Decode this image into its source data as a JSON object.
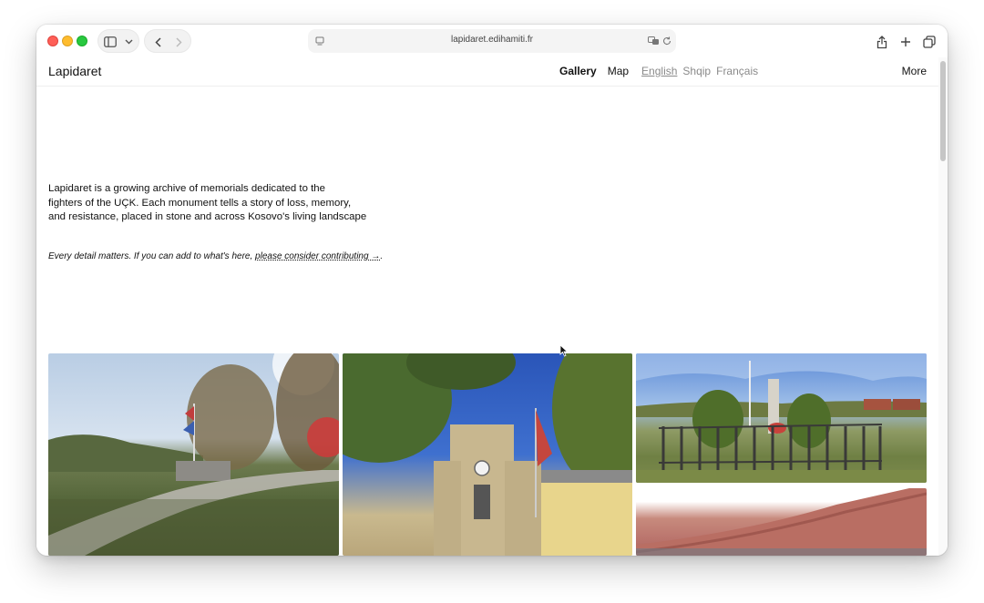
{
  "browser": {
    "url": "lapidaret.edihamiti.fr"
  },
  "site": {
    "logo": "Lapidaret",
    "nav": {
      "gallery": "Gallery",
      "map": "Map",
      "languages": [
        "English",
        "Shqip",
        "Français"
      ],
      "more": "More"
    },
    "intro_line1": "Lapidaret is a growing archive of memorials dedicated to the",
    "intro_line2": "fighters of the UÇK. Each monument tells a story of loss, memory,",
    "intro_line3": "and resistance, placed in stone and across Kosovo's living landscape",
    "contribute_prefix": "Every detail matters. If you can add to what's here, ",
    "contribute_link": "please consider contributing →",
    "contribute_suffix": "."
  },
  "colors": {
    "traffic_red": "#fe5f57",
    "traffic_yellow": "#febc2e",
    "traffic_green": "#28c840"
  }
}
